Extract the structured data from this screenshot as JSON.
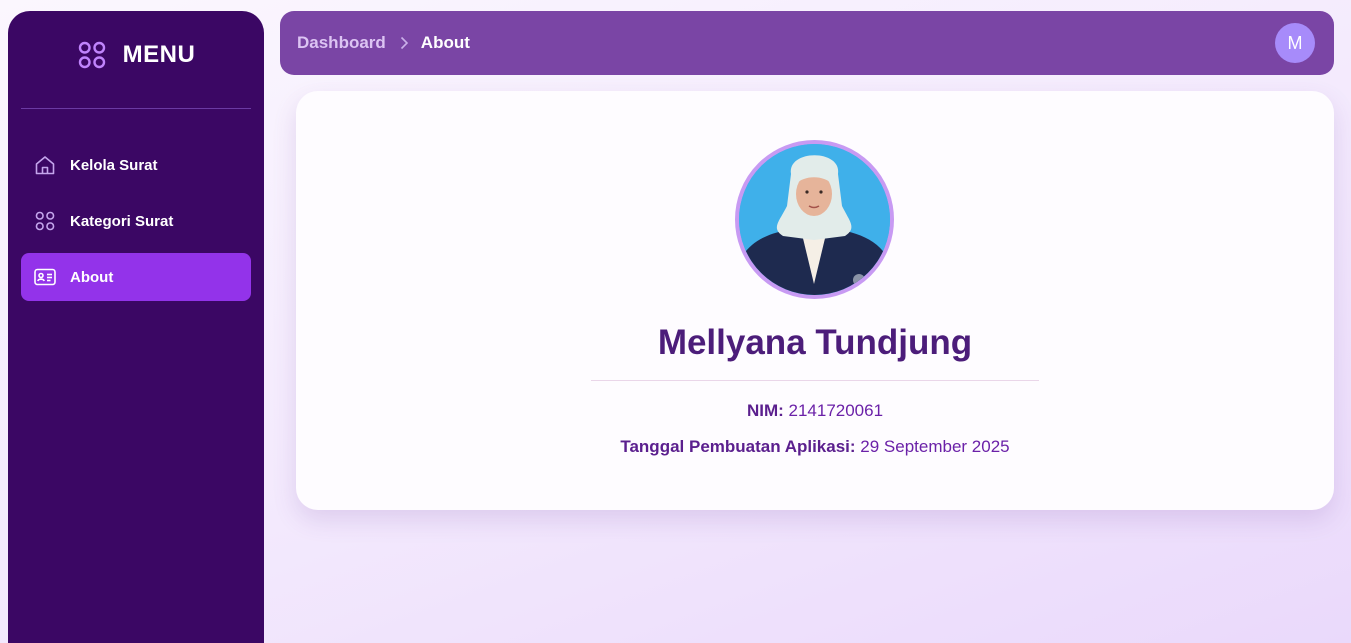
{
  "sidebar": {
    "title": "MENU",
    "items": [
      {
        "label": "Kelola Surat",
        "icon": "home-icon",
        "active": false
      },
      {
        "label": "Kategori Surat",
        "icon": "grid-icon",
        "active": false
      },
      {
        "label": "About",
        "icon": "id-card-icon",
        "active": true
      }
    ]
  },
  "header": {
    "breadcrumb": {
      "parent": "Dashboard",
      "current": "About"
    },
    "avatar_initial": "M"
  },
  "profile": {
    "name": "Mellyana Tundjung",
    "nim_label": "NIM:",
    "nim_value": "2141720061",
    "date_label": "Tanggal Pembuatan Aplikasi:",
    "date_value": "29 September 2025"
  },
  "colors": {
    "sidebar_bg": "#3b0764",
    "active_item": "#9333ea",
    "topbar_bg": "#7a45a5",
    "accent": "#a78bfa",
    "name_text": "#4c1d7a"
  }
}
